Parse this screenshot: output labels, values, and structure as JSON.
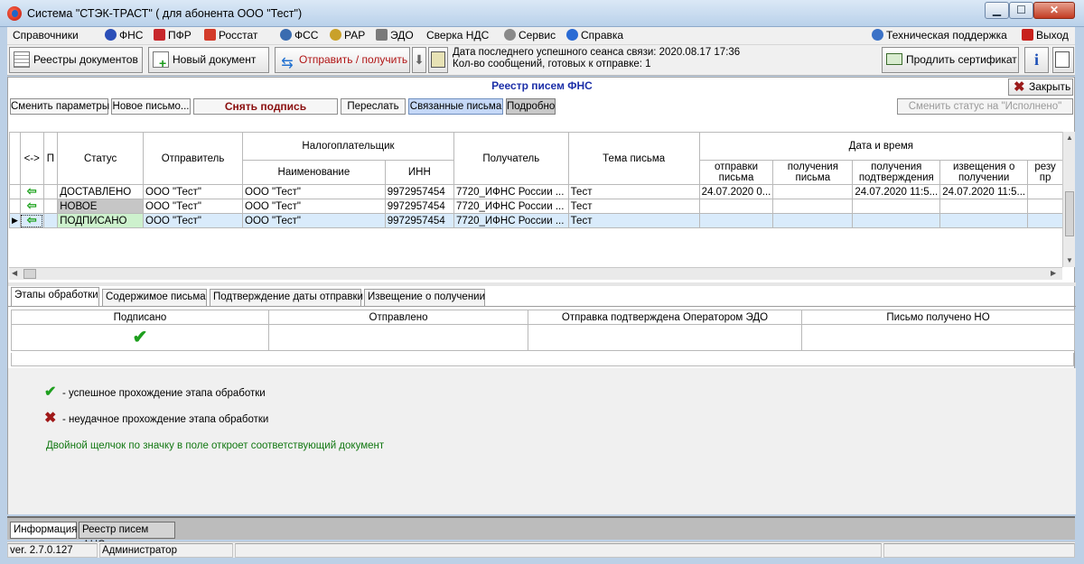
{
  "window": {
    "title": "Система \"СТЭК-ТРАСТ\" ( для абонента ООО \"Тест\")",
    "min_glyph": "▁",
    "max_glyph": "☐",
    "close_glyph": "✕"
  },
  "menu": {
    "items": [
      "Справочники",
      "ФНС",
      "ПФР",
      "Росстат",
      "ФСС",
      "РАР",
      "ЭДО",
      "Сверка НДС",
      "Сервис",
      "Справка"
    ],
    "support": "Техническая поддержка",
    "exit": "Выход"
  },
  "toolbar": {
    "registers": "Реестры документов",
    "new_document": "Новый документ",
    "send_receive": "Отправить / получить",
    "last_session": "Дата последнего успешного сеанса связи: 2020.08.17 17:36",
    "ready_count": "Кол-во сообщений, готовых к отправке: 1",
    "extend_cert": "Продлить сертификат"
  },
  "registry": {
    "title": "Реестр писем ФНС",
    "close": "Закрыть"
  },
  "actions": {
    "change_params": "Сменить параметры",
    "new_letter": "Новое письмо...",
    "remove_sign": "Снять подпись",
    "forward": "Переслать",
    "linked_letters": "Связанные письма",
    "details": "Подробно",
    "set_status": "Сменить статус на \"Исполнено\""
  },
  "grid": {
    "headers": {
      "direction": "<->",
      "p": "П",
      "status": "Статус",
      "sender": "Отправитель",
      "taxpayer": "Налогоплательщик",
      "name": "Наименование",
      "inn": "ИНН",
      "receiver": "Получатель",
      "subject": "Тема письма",
      "datetime": "Дата и время",
      "sent": "отправки письма",
      "received": "получения письма",
      "confirm": "получения подтверждения",
      "notice": "извещения о получении",
      "result": "резу пр"
    },
    "rows": [
      {
        "status": "ДОСТАВЛЕНО",
        "sender": "ООО \"Тест\"",
        "name": "ООО \"Тест\"",
        "inn": "9972957454",
        "receiver": "7720_ИФНС России ...",
        "subject": "Тест",
        "sent": "24.07.2020 0...",
        "received": "",
        "confirm": "24.07.2020 11:5...",
        "notice": "24.07.2020 11:5..."
      },
      {
        "status": "НОВОЕ",
        "sender": "ООО \"Тест\"",
        "name": "ООО \"Тест\"",
        "inn": "9972957454",
        "receiver": "7720_ИФНС России ...",
        "subject": "Тест",
        "sent": "",
        "received": "",
        "confirm": "",
        "notice": ""
      },
      {
        "status": "ПОДПИСАНО",
        "sender": "ООО \"Тест\"",
        "name": "ООО \"Тест\"",
        "inn": "9972957454",
        "receiver": "7720_ИФНС России ...",
        "subject": "Тест",
        "sent": "",
        "received": "",
        "confirm": "",
        "notice": ""
      }
    ]
  },
  "tabs": [
    "Этапы обработки",
    "Содержимое письма",
    "Подтверждение даты отправки",
    "Извещение о получении"
  ],
  "stages": {
    "headers": [
      "Подписано",
      "Отправлено",
      "Отправка подтверждена Оператором ЭДО",
      "Письмо получено НО"
    ]
  },
  "legend": {
    "success": "-  успешное прохождение этапа обработки",
    "fail": "-  неудачное прохождение этапа обработки",
    "hint": "Двойной щелчок по значку в поле откроет соответствующий документ"
  },
  "bottom_tabs": [
    "Информация",
    "Реестр писем ФНС"
  ],
  "status": {
    "version": "ver. 2.7.0.127",
    "user": "Администратор"
  }
}
